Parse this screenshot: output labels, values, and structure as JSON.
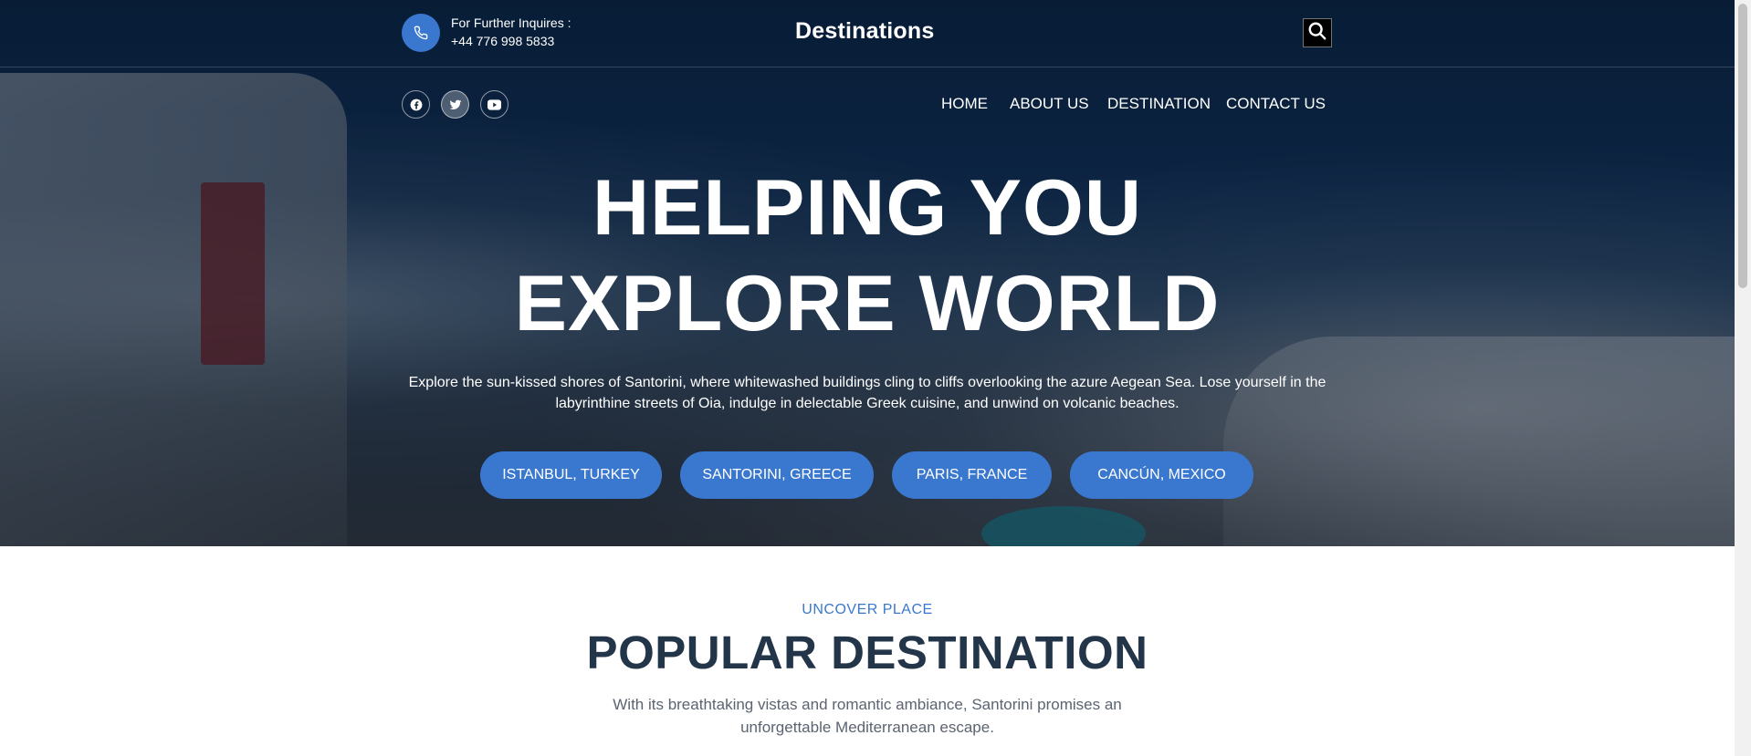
{
  "header": {
    "contact_label": "For Further Inquires :",
    "contact_phone": "+44 776 998 5833",
    "brand": "Destinations",
    "icons": {
      "phone": "phone-icon",
      "search": "search-icon"
    }
  },
  "social": [
    {
      "name": "facebook-icon"
    },
    {
      "name": "twitter-icon"
    },
    {
      "name": "youtube-icon"
    }
  ],
  "nav": {
    "items": [
      {
        "label": "HOME"
      },
      {
        "label": "ABOUT US"
      },
      {
        "label": "DESTINATION"
      },
      {
        "label": "CONTACT US"
      }
    ]
  },
  "hero": {
    "title_line1": "HELPING YOU",
    "title_line2": "EXPLORE WORLD",
    "description": "Explore the sun-kissed shores of Santorini, where whitewashed buildings cling to cliffs overlooking the azure Aegean Sea. Lose yourself in the labyrinthine streets of Oia, indulge in delectable Greek cuisine, and unwind on volcanic beaches.",
    "destinations": [
      {
        "label": "ISTANBUL, TURKEY"
      },
      {
        "label": "SANTORINI, GREECE"
      },
      {
        "label": "PARIS, FRANCE"
      },
      {
        "label": "CANCÚN, MEXICO"
      }
    ]
  },
  "popular": {
    "eyebrow": "UNCOVER PLACE",
    "title": "POPULAR DESTINATION",
    "text": "With its breathtaking vistas and romantic ambiance, Santorini promises an unforgettable Mediterranean escape."
  },
  "colors": {
    "accent": "#3a78d0",
    "heading": "#233549",
    "body_text": "#5b6470"
  }
}
